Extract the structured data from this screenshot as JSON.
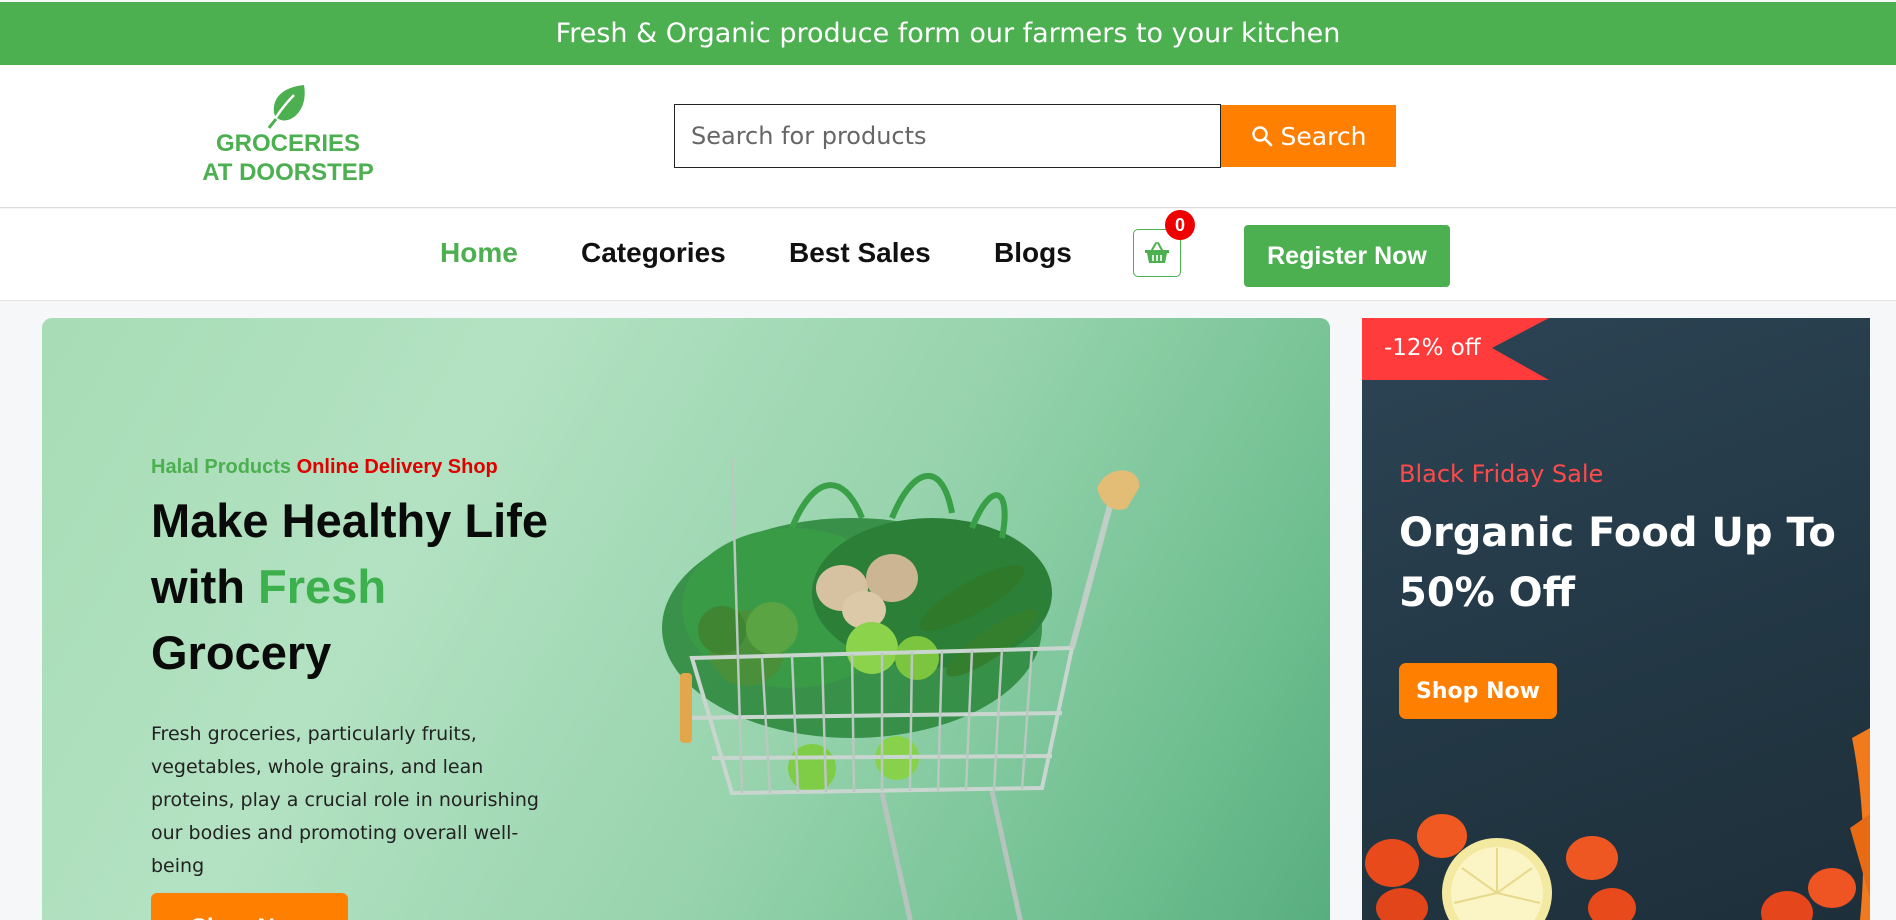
{
  "topbar": {
    "text": "Fresh & Organic produce form our farmers to your kitchen"
  },
  "logo": {
    "line1": "GROCERIES",
    "line2": "AT DOORSTEP"
  },
  "search": {
    "placeholder": "Search for products",
    "button_label": "Search"
  },
  "nav": {
    "items": [
      {
        "label": "Home",
        "active": true
      },
      {
        "label": "Categories"
      },
      {
        "label": "Best Sales"
      },
      {
        "label": "Blogs"
      }
    ],
    "cart_count": "0",
    "register_label": "Register Now"
  },
  "hero": {
    "tag_green": "Halal Products",
    "tag_red": "Online Delivery Shop",
    "title_part1": "Make Healthy Life with",
    "title_highlight": "Fresh",
    "title_part2": "Grocery",
    "description": "Fresh groceries, particularly fruits, vegetables, whole grains, and lean proteins, play a crucial role in nourishing our bodies and promoting overall well-being",
    "button_label": "Shop Now"
  },
  "promo": {
    "discount": "-12% off",
    "subtitle": "Black Friday Sale",
    "title": "Organic Food Up To 50% Off",
    "button_label": "Shop Now"
  },
  "colors": {
    "brand_green": "#4caf50",
    "accent_orange": "#ff7f00",
    "sale_red": "#ff3b3b"
  }
}
